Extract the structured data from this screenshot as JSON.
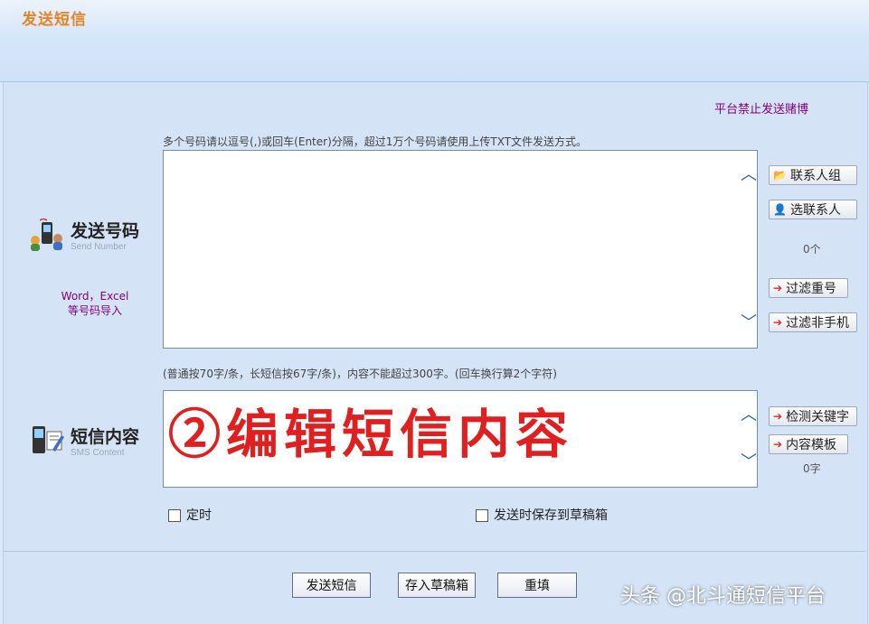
{
  "app": {
    "title": "发送短信"
  },
  "notice": "平台禁止发送赌博",
  "numbers": {
    "hint": "多个号码请以逗号(,)或回车(Enter)分隔，超过1万个号码请使用上传TXT文件发送方式。",
    "label_cn": "发送号码",
    "label_en": "Send Number",
    "import_line1": "Word，Excel",
    "import_line2": "等号码导入",
    "count": "0个",
    "buttons": {
      "contact_group": "联系人组",
      "select_contact": "选联系人",
      "filter_duplicate": "过滤重号",
      "filter_non_mobile": "过滤非手机"
    }
  },
  "content": {
    "hint": "(普通按70字/条，长短信按67字/条)，内容不能超过300字。(回车换行算2个字符)",
    "label_cn": "短信内容",
    "label_en": "SMS Content",
    "overlay_text": "②编辑短信内容",
    "count": "0字",
    "buttons": {
      "detect_keywords": "检测关键字",
      "content_template": "内容模板"
    }
  },
  "options": {
    "scheduled": "定时",
    "save_draft_on_send": "发送时保存到草稿箱"
  },
  "actions": {
    "send": "发送短信",
    "save_draft": "存入草稿箱",
    "reset": "重填"
  },
  "watermark": "头条 @北斗通短信平台",
  "colors": {
    "title": "#e58526",
    "notice": "#800080",
    "overlay": "#e02020",
    "arrow": "#2a5db0"
  }
}
